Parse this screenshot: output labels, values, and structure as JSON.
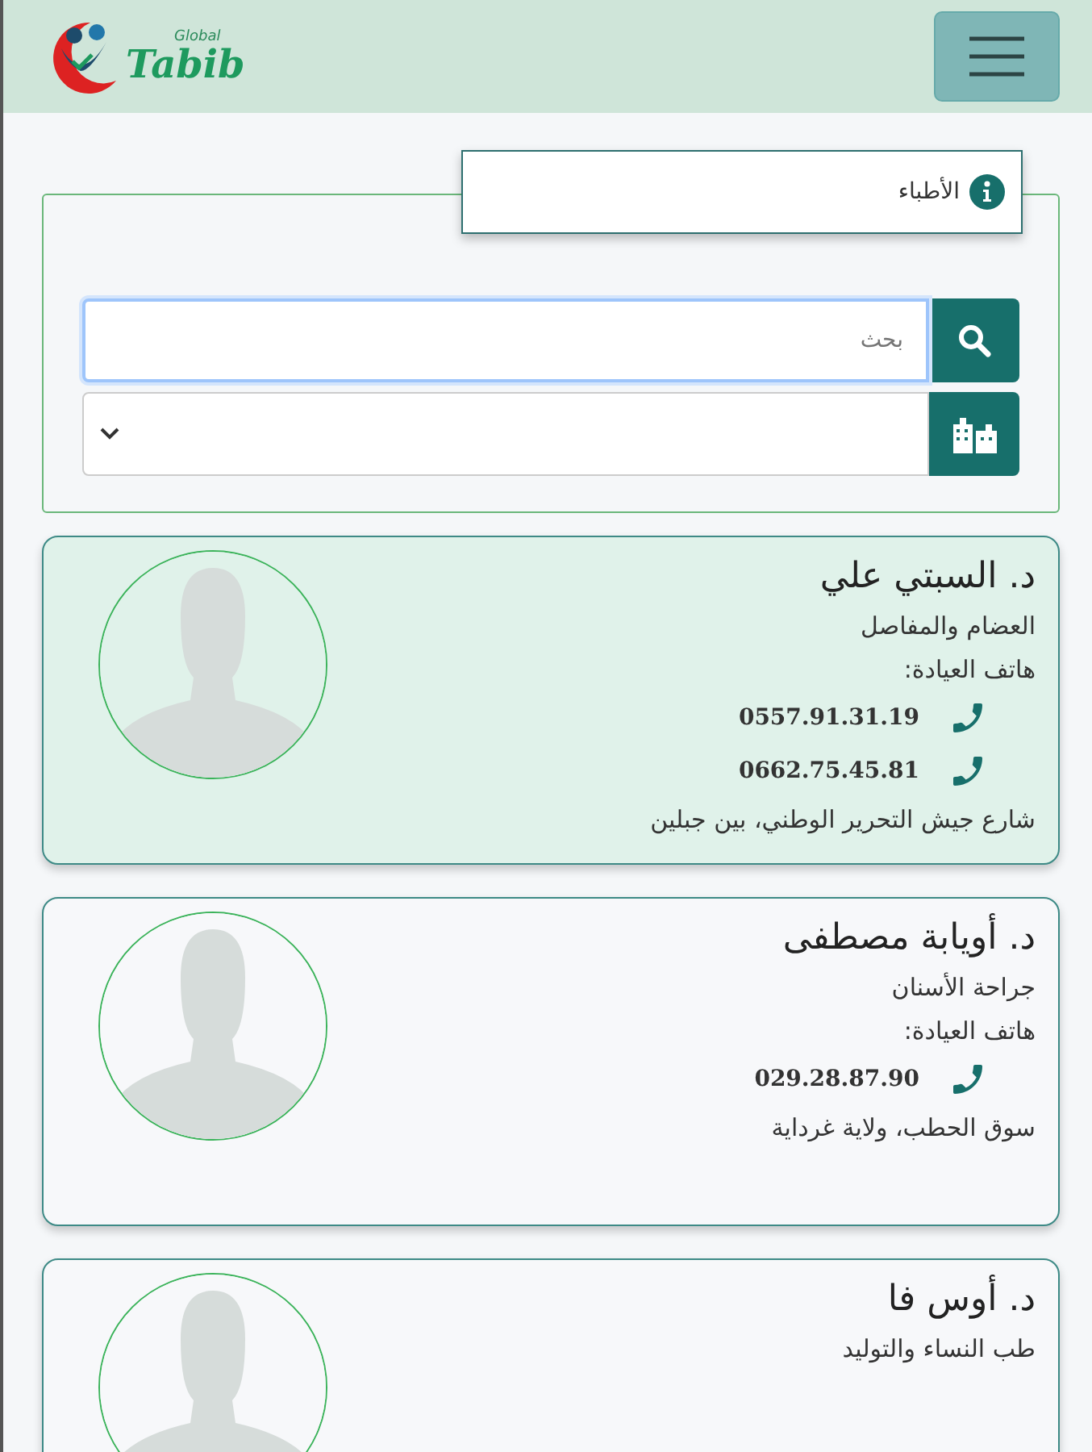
{
  "logo": {
    "small_text": "Global",
    "brand": "Tabib"
  },
  "filter_panel": {
    "legend": "الأطباء",
    "search": {
      "placeholder": "بحث"
    }
  },
  "doctors": [
    {
      "name": "د. السبتي علي",
      "specialty": "العضام والمفاصل",
      "phone_label": "هاتف العيادة:",
      "phones": [
        "0557.91.31.19",
        "0662.75.45.81"
      ],
      "address": "شارع جيش التحرير الوطني، بين جبلين",
      "selected": true
    },
    {
      "name": "د. أويابة مصطفى",
      "specialty": "جراحة الأسنان",
      "phone_label": "هاتف العيادة:",
      "phones": [
        "029.28.87.90"
      ],
      "address": "سوق الحطب، ولاية غرداية",
      "selected": false
    },
    {
      "name": "د. أوس فا",
      "specialty": "طب النساء والتوليد",
      "selected": false
    }
  ]
}
